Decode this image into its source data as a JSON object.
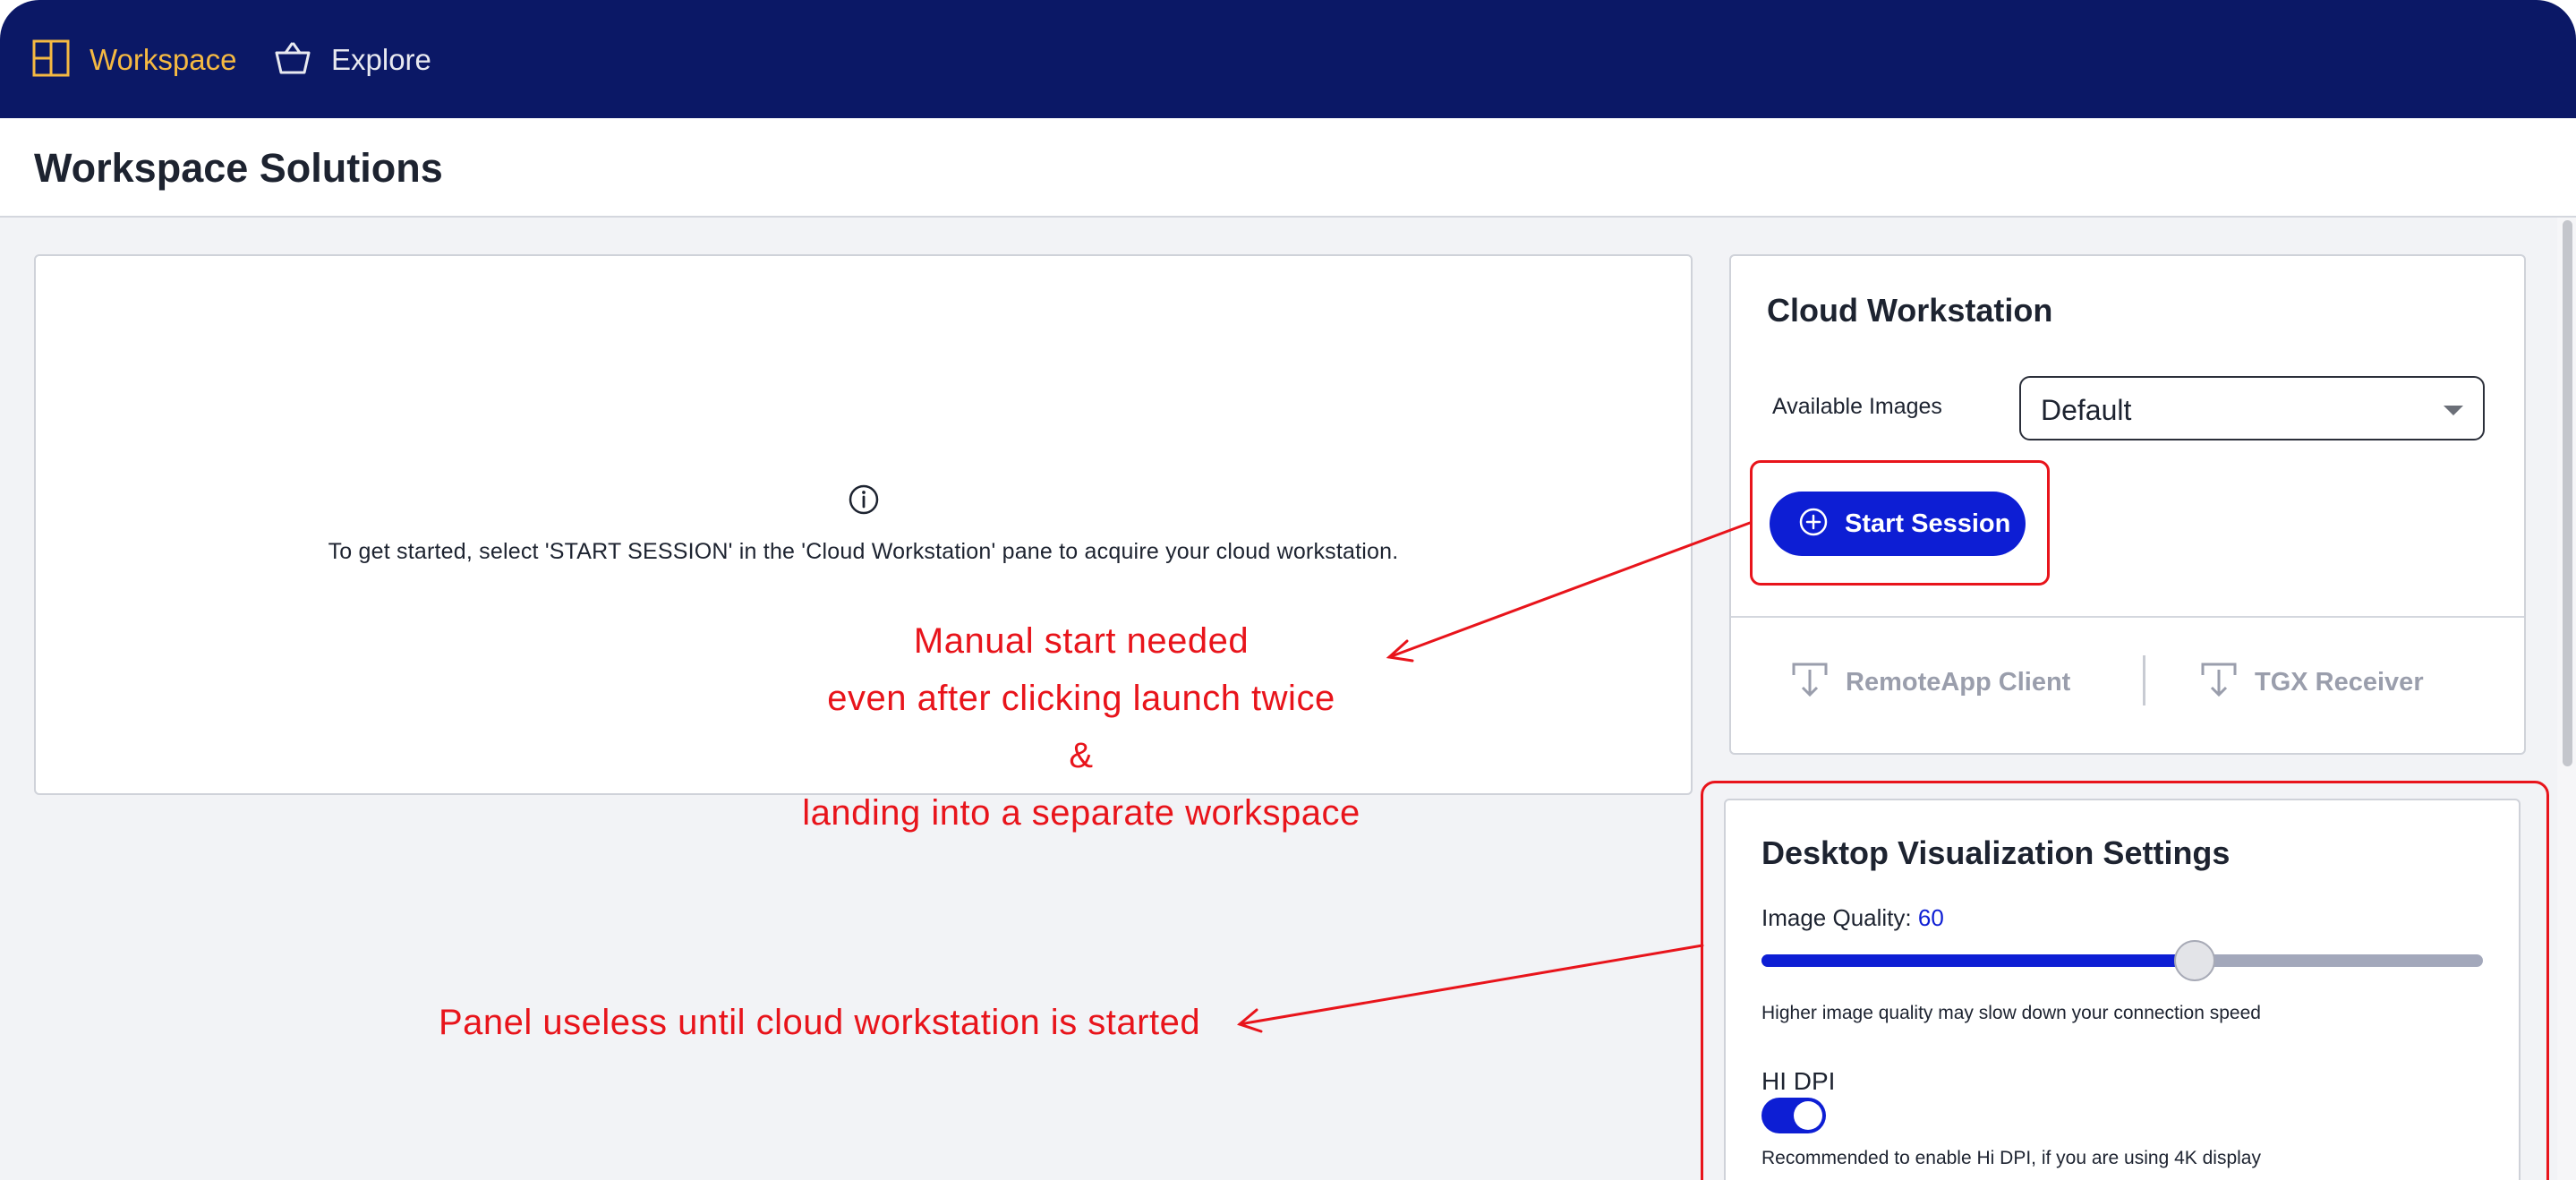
{
  "nav": {
    "workspace_label": "Workspace",
    "explore_label": "Explore",
    "workspace_icon": "grid-layout-icon",
    "explore_icon": "basket-icon",
    "active_color": "#f5b942",
    "background_color": "#0b1866"
  },
  "page": {
    "title": "Workspace Solutions"
  },
  "empty_state": {
    "icon": "info-icon",
    "message": "To get started, select 'START SESSION' in the 'Cloud Workstation' pane to acquire your cloud workstation."
  },
  "cloud_workstation": {
    "title": "Cloud Workstation",
    "available_images_label": "Available Images",
    "selected_image": "Default",
    "start_button_label": "Start Session",
    "downloads": [
      {
        "label": "RemoteApp Client",
        "icon": "download-icon"
      },
      {
        "label": "TGX Receiver",
        "icon": "download-icon"
      }
    ],
    "accent_color": "#0d1ed4"
  },
  "desktop_visualization": {
    "title": "Desktop Visualization Settings",
    "image_quality_label": "Image Quality:",
    "image_quality_value": "60",
    "image_quality_fraction": 0.6,
    "image_quality_hint": "Higher image quality may slow down your connection speed",
    "hidpi_label": "HI DPI",
    "hidpi_enabled": true,
    "hidpi_hint": "Recommended to enable Hi DPI, if you are using 4K display"
  },
  "annotations": {
    "color": "#e8141b",
    "session_note": [
      "Manual start needed",
      "even after clicking launch twice",
      "&",
      "landing into a separate workspace"
    ],
    "panel_note": "Panel useless until cloud workstation is started"
  }
}
